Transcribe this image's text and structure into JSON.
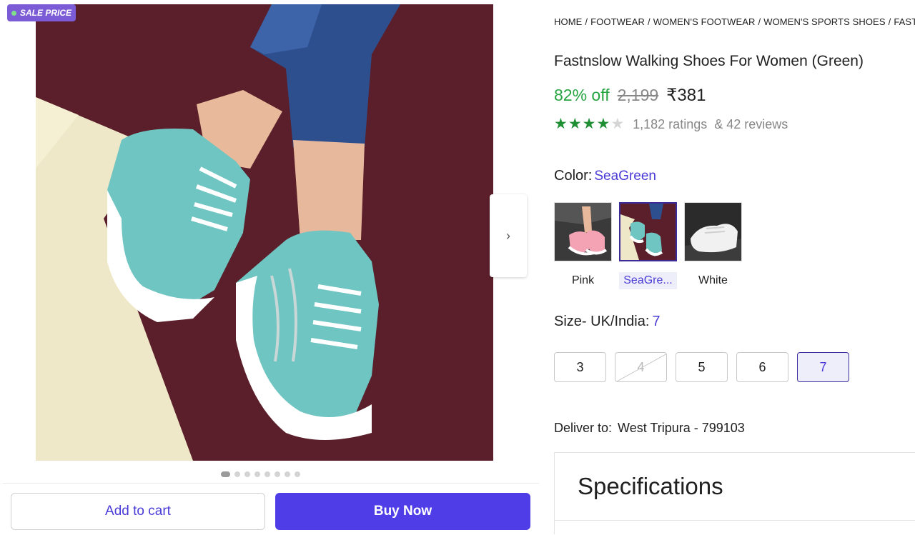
{
  "badge": {
    "label": "SALE PRICE"
  },
  "breadcrumb": [
    "HOME",
    "FOOTWEAR",
    "WOMEN'S FOOTWEAR",
    "WOMEN'S SPORTS SHOES",
    "FASTNSLOW"
  ],
  "product": {
    "title": "Fastnslow Walking Shoes For Women (Green)",
    "discount": "82% off",
    "mrp": "2,199",
    "price": "₹381",
    "rating_stars": 4,
    "ratings_count": "1,182 ratings",
    "reviews_count": "& 42 reviews"
  },
  "color": {
    "label": "Color:",
    "selected": "SeaGreen",
    "options": [
      {
        "label": "Pink"
      },
      {
        "label": "SeaGre..."
      },
      {
        "label": "White"
      }
    ]
  },
  "size": {
    "label": "Size- UK/India:",
    "selected": "7",
    "options": [
      "3",
      "4",
      "5",
      "6",
      "7"
    ]
  },
  "delivery": {
    "label": "Deliver to:",
    "location": "West Tripura - 799103"
  },
  "specs": {
    "title": "Specifications"
  },
  "actions": {
    "add_to_cart": "Add to cart",
    "buy_now": "Buy Now"
  },
  "carousel": {
    "total_images": 8,
    "active_index": 0,
    "next_icon": "chevron-right-icon"
  },
  "colors": {
    "accent": "#4f3ee8",
    "discount": "#26a541",
    "star": "#1f8f34",
    "badge": "#7c5cd6"
  }
}
